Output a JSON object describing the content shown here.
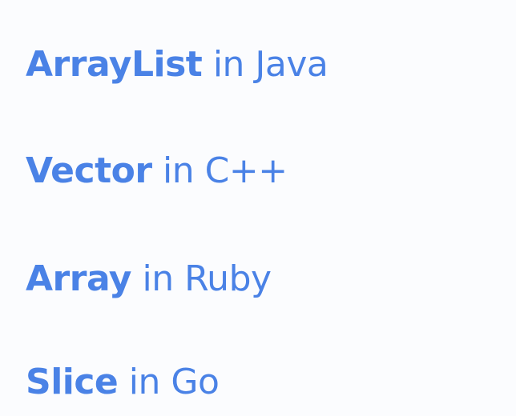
{
  "theme": {
    "text_color": "#4a82e6",
    "background": "#fbfcfe"
  },
  "lines": [
    {
      "name": "ArrayList",
      "lang": "in Java"
    },
    {
      "name": "Vector",
      "lang": "in C++"
    },
    {
      "name": "Array",
      "lang": "in Ruby"
    },
    {
      "name": "Slice",
      "lang": "in Go"
    }
  ]
}
